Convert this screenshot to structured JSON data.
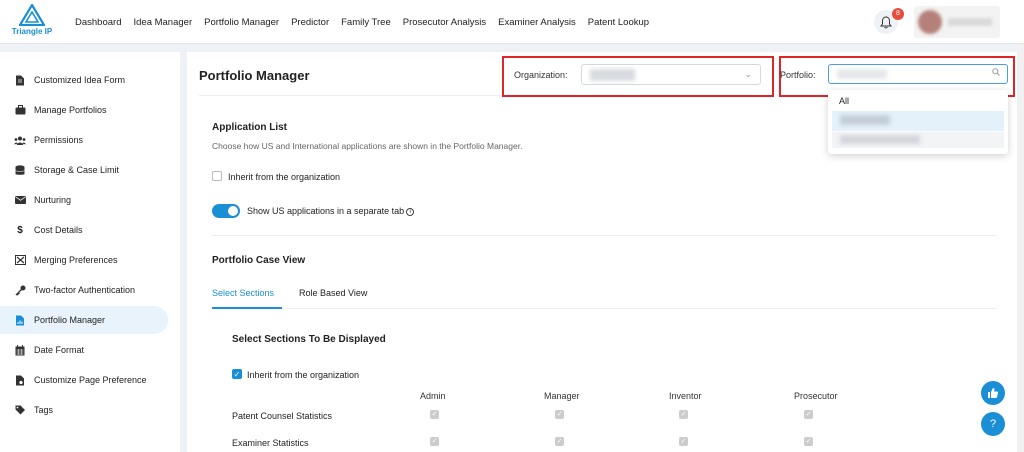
{
  "brand": {
    "name": "Triangle IP"
  },
  "nav": [
    "Dashboard",
    "Idea Manager",
    "Portfolio Manager",
    "Predictor",
    "Family Tree",
    "Prosecutor Analysis",
    "Examiner Analysis",
    "Patent Lookup"
  ],
  "notifications": {
    "count": "8"
  },
  "sidebar": {
    "items": [
      {
        "label": "Customized Idea Form",
        "icon": "document-icon"
      },
      {
        "label": "Manage Portfolios",
        "icon": "briefcase-icon"
      },
      {
        "label": "Permissions",
        "icon": "users-icon"
      },
      {
        "label": "Storage & Case Limit",
        "icon": "database-icon"
      },
      {
        "label": "Nurturing",
        "icon": "envelope-icon"
      },
      {
        "label": "Cost Details",
        "icon": "dollar-icon"
      },
      {
        "label": "Merging Preferences",
        "icon": "merge-icon"
      },
      {
        "label": "Two-factor Authentication",
        "icon": "key-icon"
      },
      {
        "label": "Portfolio Manager",
        "icon": "chart-file-icon",
        "active": true
      },
      {
        "label": "Date Format",
        "icon": "calendar-icon"
      },
      {
        "label": "Customize Page Preference",
        "icon": "file-settings-icon"
      },
      {
        "label": "Tags",
        "icon": "tags-icon"
      }
    ]
  },
  "main": {
    "title": "Portfolio Manager",
    "organization_label": "Organization:",
    "portfolio_label": "Portfolio:",
    "portfolio_dropdown_first": "All",
    "application_list": {
      "title": "Application List",
      "description": "Choose how US and International applications are shown in the Portfolio Manager.",
      "inherit_label": "Inherit from the organization",
      "toggle_label": "Show US applications in a separate tab"
    },
    "case_view": {
      "title": "Portfolio Case View",
      "tabs": [
        "Select Sections",
        "Role Based View"
      ],
      "subtitle": "Select Sections To Be Displayed",
      "inherit_label": "Inherit from the organization",
      "columns": [
        "Admin",
        "Manager",
        "Inventor",
        "Prosecutor"
      ],
      "rows": [
        "Patent Counsel Statistics",
        "Examiner Statistics"
      ]
    }
  },
  "colors": {
    "accent": "#1a8fd6",
    "highlight_border": "#e0242a"
  }
}
